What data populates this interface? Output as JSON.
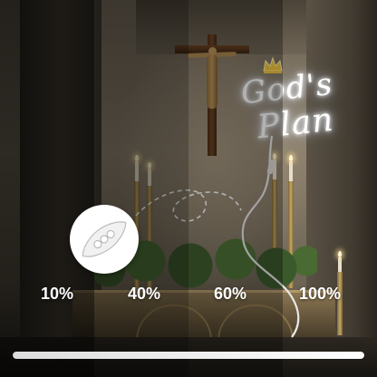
{
  "brightness_levels": [
    {
      "label": "10%",
      "level": 0.1
    },
    {
      "label": "40%",
      "level": 0.4
    },
    {
      "label": "60%",
      "level": 0.6
    },
    {
      "label": "100%",
      "level": 1.0
    }
  ],
  "neon_sign": {
    "line1": "God's",
    "line2": "Plan",
    "glow_color": "#ffffff",
    "crown_color": "#f2c53d"
  },
  "slider": {
    "level": 1.0
  },
  "colors": {
    "label_text": "#ffffff",
    "overlay": "#000000"
  },
  "icons": {
    "remote": "dimmer-remote-icon",
    "crown": "crown-icon",
    "crucifix": "crucifix-icon"
  }
}
